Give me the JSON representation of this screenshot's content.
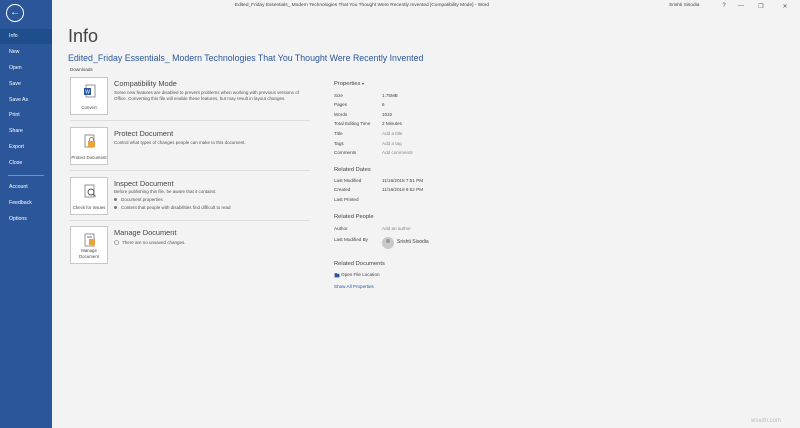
{
  "app": {
    "window_title": "Edited_Friday Essentials_ Modern Technologies That You Thought Were Recently Invented [Compatibility Mode]  -  Word",
    "user_name": "Srishti Sisodia",
    "window_controls": {
      "help": "?",
      "minimize": "—",
      "restore": "❐",
      "close": "✕"
    },
    "colors": {
      "nav_bg": "#2b579a",
      "nav_active": "#1f4e8c",
      "accent": "#2b579a",
      "page_bg": "#f3f3f3"
    }
  },
  "nav": {
    "back_icon": "back-arrow-icon",
    "items": [
      {
        "label": "Info",
        "active": true
      },
      {
        "label": "New"
      },
      {
        "label": "Open"
      },
      {
        "label": "Save"
      },
      {
        "label": "Save As"
      },
      {
        "label": "Print"
      },
      {
        "label": "Share"
      },
      {
        "label": "Export"
      },
      {
        "label": "Close"
      },
      {
        "label": "Account"
      },
      {
        "label": "Feedback"
      },
      {
        "label": "Options"
      }
    ]
  },
  "main": {
    "title": "Info",
    "doc_title": "Edited_Friday Essentials_ Modern Technologies That You Thought Were Recently Invented",
    "doc_path": "Downloads",
    "sections": [
      {
        "button_label": "Convert",
        "icon": "convert-document-icon",
        "title": "Compatibility Mode",
        "description": "Some new features are disabled to prevent problems when working with previous versions of Office. Converting this file will enable these features, but may result in layout changes."
      },
      {
        "button_label": "Protect Document",
        "icon": "lock-document-icon",
        "title": "Protect Document",
        "description": "Control what types of changes people can make to this document."
      },
      {
        "button_label": "Check for Issues",
        "icon": "check-issues-icon",
        "title": "Inspect Document",
        "description": "Before publishing this file, be aware that it contains:",
        "bullets": [
          "Document properties",
          "Content that people with disabilities find difficult to read"
        ]
      },
      {
        "button_label": "Manage Document",
        "icon": "manage-document-icon",
        "title": "Manage Document",
        "description": "There are no unsaved changes."
      }
    ]
  },
  "properties": {
    "heading": "Properties",
    "rows": [
      {
        "key": "Size",
        "value": "1.75MB"
      },
      {
        "key": "Pages",
        "value": "6"
      },
      {
        "key": "Words",
        "value": "1022"
      },
      {
        "key": "Total Editing Time",
        "value": "2 Minutes"
      },
      {
        "key": "Title",
        "value": "Add a title"
      },
      {
        "key": "Tags",
        "value": "Add a tag"
      },
      {
        "key": "Comments",
        "value": "Add comments"
      }
    ],
    "related_dates": {
      "heading": "Related Dates",
      "rows": [
        {
          "key": "Last Modified",
          "value": "11/16/2018 7:51 PM"
        },
        {
          "key": "Created",
          "value": "11/16/2018 6:52 PM"
        },
        {
          "key": "Last Printed",
          "value": ""
        }
      ]
    },
    "related_people": {
      "heading": "Related People",
      "author_key": "Author",
      "author_placeholder": "Add an author",
      "last_modified_by_key": "Last Modified By",
      "last_modified_by": "Srishti Sisodia"
    },
    "related_documents": {
      "heading": "Related Documents",
      "open_location": "Open File Location",
      "show_all": "Show All Properties"
    }
  },
  "watermark": "wsxdn.com"
}
